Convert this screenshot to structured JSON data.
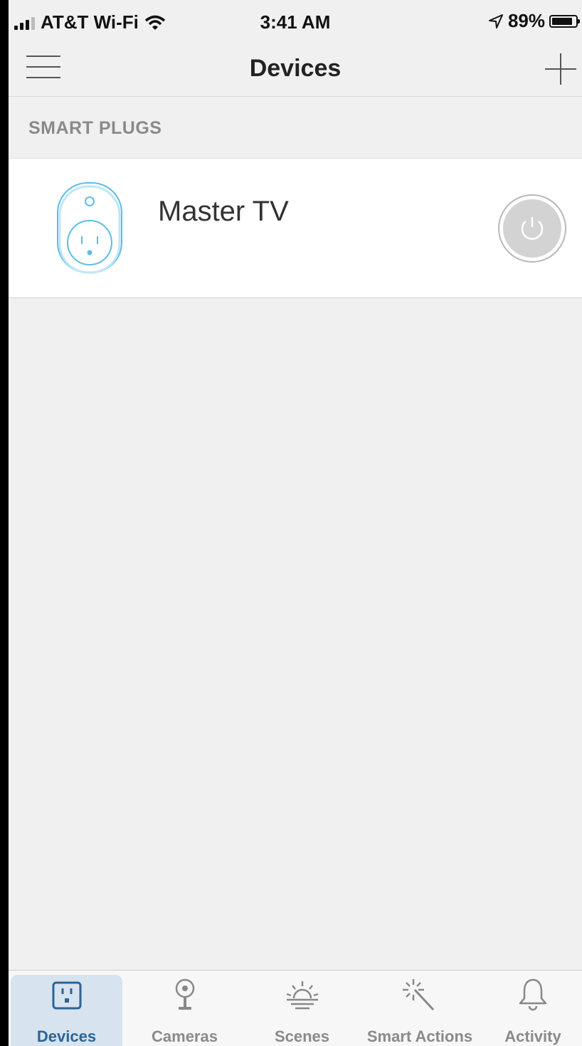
{
  "status_bar": {
    "carrier": "AT&T Wi-Fi",
    "time": "3:41 AM",
    "battery": "89%"
  },
  "nav": {
    "title": "Devices"
  },
  "section": {
    "header": "SMART PLUGS"
  },
  "devices": [
    {
      "name": "Master TV",
      "type": "smart-plug",
      "power_state": "off"
    }
  ],
  "tabs": [
    {
      "label": "Devices",
      "icon": "outlet-icon",
      "active": true
    },
    {
      "label": "Cameras",
      "icon": "camera-icon",
      "active": false
    },
    {
      "label": "Scenes",
      "icon": "sunrise-icon",
      "active": false
    },
    {
      "label": "Smart Actions",
      "icon": "magic-wand-icon",
      "active": false
    },
    {
      "label": "Activity",
      "icon": "bell-icon",
      "active": false
    }
  ],
  "colors": {
    "accent": "#2c6496",
    "plug_outline": "#5bbde8",
    "background": "#f0f0f0"
  }
}
